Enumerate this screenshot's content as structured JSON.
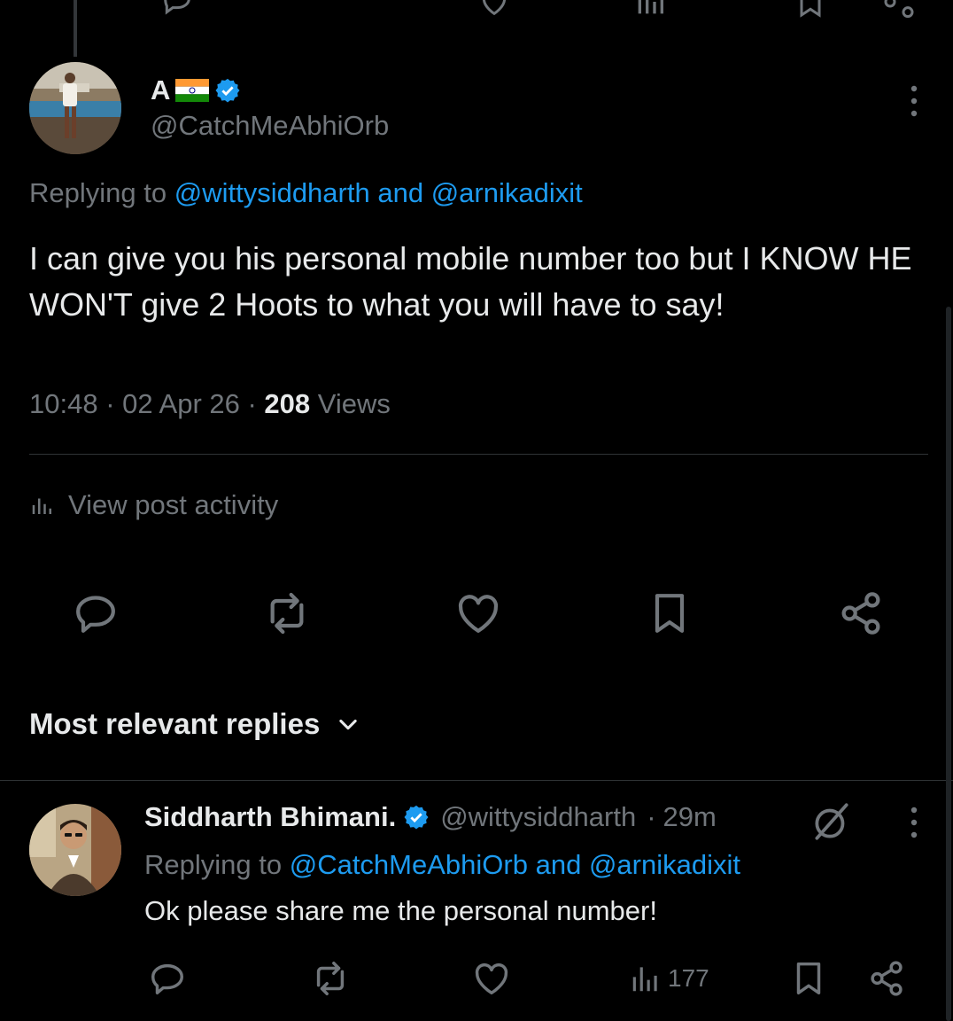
{
  "tweet": {
    "author_name": "A",
    "author_handle": "@CatchMeAbhiOrb",
    "replying_prefix": "Replying to",
    "replying_user1": "@wittysiddharth",
    "replying_and": "and",
    "replying_user2": "@arnikadixit",
    "text": "I can give you his personal mobile number too but I KNOW HE WON'T give 2 Hoots to what you will have to say!",
    "time": "10:48",
    "date": "02 Apr 26",
    "views_count": "208",
    "views_label": "Views",
    "activity_label": "View post activity"
  },
  "replies_sort": {
    "label": "Most relevant replies"
  },
  "reply": {
    "author_name": "Siddharth Bhimani.",
    "author_handle": "@wittysiddharth",
    "age": "29m",
    "replying_prefix": "Replying to",
    "replying_user1": "@CatchMeAbhiOrb",
    "replying_and": "and",
    "replying_user2": "@arnikadixit",
    "text": "Ok please share me the personal number!",
    "views_count": "177"
  },
  "colors": {
    "background": "#000000",
    "text_primary": "#e7e9ea",
    "text_secondary": "#71767b",
    "accent": "#1d9bf0",
    "divider": "#2f3336"
  },
  "icons": {
    "verified": "verified-badge-icon",
    "flag": "india-flag-icon",
    "more": "more-vertical-icon",
    "activity": "analytics-icon",
    "reply": "reply-icon",
    "repost": "repost-icon",
    "like": "heart-icon",
    "bookmark": "bookmark-icon",
    "share": "share-icon",
    "chevron": "chevron-down-icon",
    "grok": "grok-icon",
    "views": "views-icon"
  }
}
